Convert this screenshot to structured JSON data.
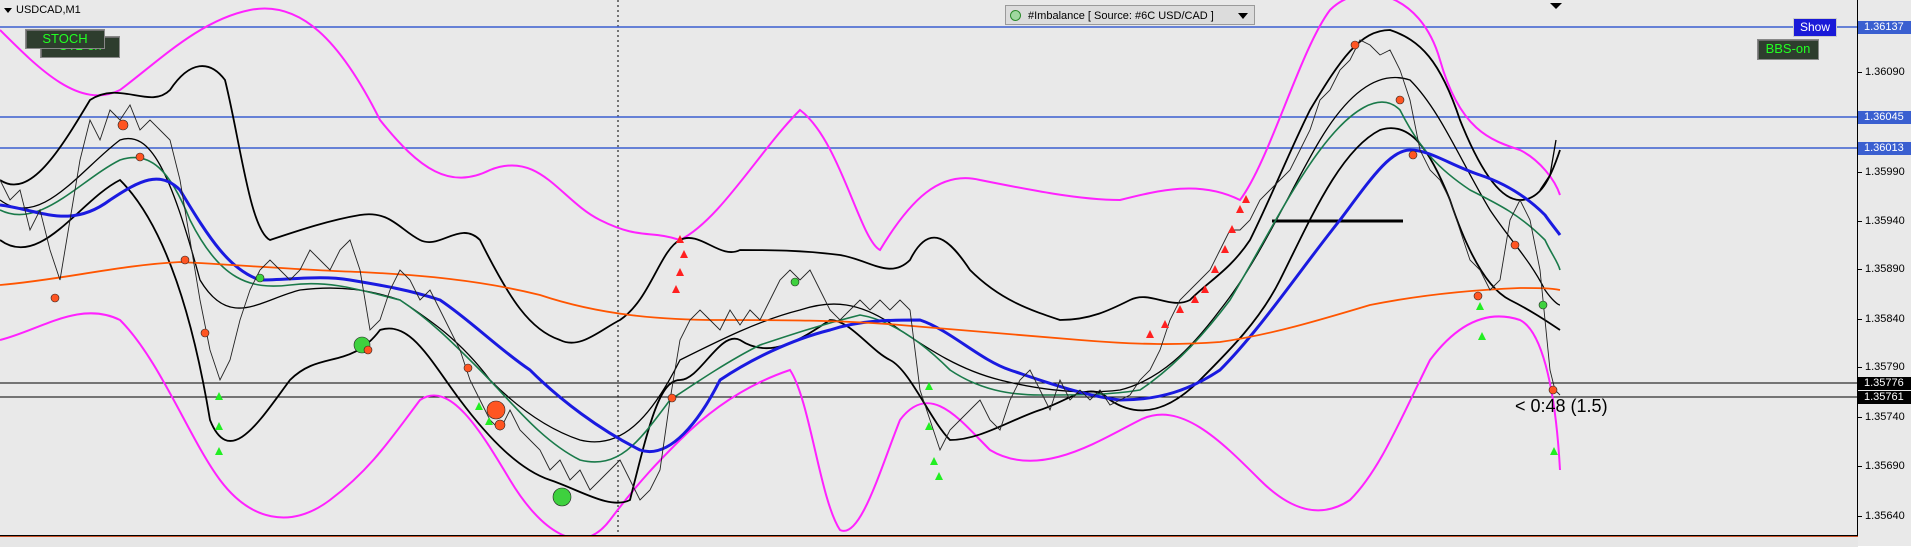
{
  "window": {
    "symbol_label": "USDCAD,M1"
  },
  "buttons": {
    "stoch": "STOCH",
    "ct2": "CT2-on",
    "bbs": "BBS-on",
    "show": "Show"
  },
  "indicator_dropdown": {
    "label": "#Imbalance [ Source: #6C USD/CAD ]"
  },
  "countdown": {
    "text": "< 0:48 (1.5)"
  },
  "price_axis": {
    "ticks": [
      "1.36090",
      "1.35990",
      "1.35940",
      "1.35890",
      "1.35840",
      "1.35790",
      "1.35740",
      "1.35690",
      "1.35640"
    ],
    "level_labels": [
      {
        "value": "1.36137",
        "color": "#3a5fd0"
      },
      {
        "value": "1.36045",
        "color": "#3a5fd0"
      },
      {
        "value": "1.36013",
        "color": "#3a5fd0"
      },
      {
        "value": "1.35776",
        "color": "#000000"
      },
      {
        "value": "1.35761",
        "color": "#000000"
      }
    ]
  },
  "colors": {
    "background": "#e9e9e9",
    "bollinger_outer": "#ff22ff",
    "bollinger_inner": "#000000",
    "ma_fast": "#1a7a4a",
    "ma_slow": "#1a1ae0",
    "ma_long": "#ff5500",
    "level_lines": "#3a5fd0",
    "button_text": "#22ff22"
  },
  "chart_data": {
    "type": "line",
    "ylim": [
      1.3561,
      1.3617
    ],
    "horizontal_levels": [
      1.36137,
      1.36045,
      1.36013,
      1.35776,
      1.35761
    ],
    "series": [
      {
        "values": [
          1.3597,
          1.3598,
          1.3605,
          1.3603,
          1.36,
          1.3604,
          1.3596,
          1.3581,
          1.3578,
          1.358,
          1.3586,
          1.359,
          1.3589,
          1.3588,
          1.3592,
          1.3589,
          1.359,
          1.3584,
          1.3587,
          1.3586,
          1.3582,
          1.3575,
          1.357,
          1.3579,
          1.3577,
          1.3583,
          1.3572,
          1.3564,
          1.3573,
          1.3572,
          1.3578,
          1.3592,
          1.3594,
          1.3589,
          1.3586,
          1.3592,
          1.3588,
          1.3589,
          1.359,
          1.3588,
          1.3587,
          1.358,
          1.3574,
          1.3575,
          1.3577,
          1.3578,
          1.3577,
          1.3575,
          1.3582,
          1.3586,
          1.3598,
          1.3603,
          1.3613,
          1.3617,
          1.3614,
          1.3614,
          1.3611,
          1.3604,
          1.3596,
          1.3591,
          1.3586,
          1.3591,
          1.3596,
          1.3592,
          1.3589,
          1.3585,
          1.3576,
          1.3598
        ]
      }
    ]
  }
}
